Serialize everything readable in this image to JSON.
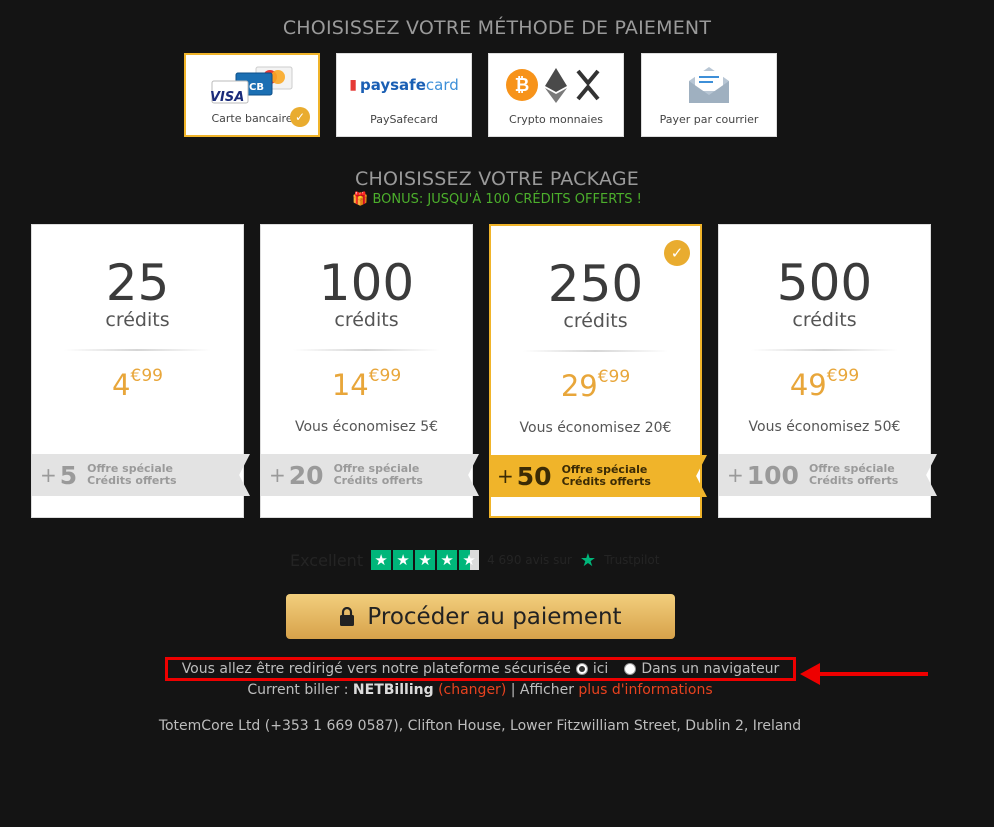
{
  "payment": {
    "title": "CHOISISSEZ VOTRE MÉTHODE DE PAIEMENT",
    "methods": [
      {
        "label": "Carte bancaire",
        "selected": true
      },
      {
        "label": "PaySafecard",
        "logo_text_1": "paysafe",
        "logo_text_2": "card"
      },
      {
        "label": "Crypto monnaies"
      },
      {
        "label": "Payer par courrier"
      }
    ],
    "card_brand_1": "VISA",
    "card_brand_2": "CB"
  },
  "package": {
    "title": "CHOISISSEZ VOTRE PACKAGE",
    "bonus": "BONUS: JUSQU'À 100 CRÉDITS OFFERTS !",
    "credits_word": "crédits",
    "offer_line1": "Offre spéciale",
    "offer_line2": "Crédits offerts",
    "items": [
      {
        "credits": "25",
        "price_main": "4",
        "price_cents": "€99",
        "save": "",
        "bonus": "5"
      },
      {
        "credits": "100",
        "price_main": "14",
        "price_cents": "€99",
        "save": "Vous économisez 5€",
        "bonus": "20"
      },
      {
        "credits": "250",
        "price_main": "29",
        "price_cents": "€99",
        "save": "Vous économisez 20€",
        "bonus": "50",
        "selected": true
      },
      {
        "credits": "500",
        "price_main": "49",
        "price_cents": "€99",
        "save": "Vous économisez 50€",
        "bonus": "100"
      }
    ]
  },
  "trustpilot": {
    "rating_word": "Excellent",
    "reviews": "4 690 avis sur",
    "brand": "Trustpilot"
  },
  "cta": {
    "label": "Procéder au paiement"
  },
  "redirect": {
    "text": "Vous allez être redirigé vers notre plateforme sécurisée",
    "opt1": "ici",
    "opt2": "Dans un navigateur"
  },
  "biller": {
    "prefix": "Current biller : ",
    "name": "NETBilling",
    "change": "changer",
    "show": "Afficher",
    "more": "plus d'informations"
  },
  "address": "TotemCore Ltd (+353 1 669 0587), Clifton House, Lower Fitzwilliam Street, Dublin 2, Ireland",
  "colors": {
    "accent": "#f0b42a",
    "bonus_green": "#4caf2c",
    "alert_red": "#e00000",
    "trustpilot_green": "#00b67a"
  }
}
